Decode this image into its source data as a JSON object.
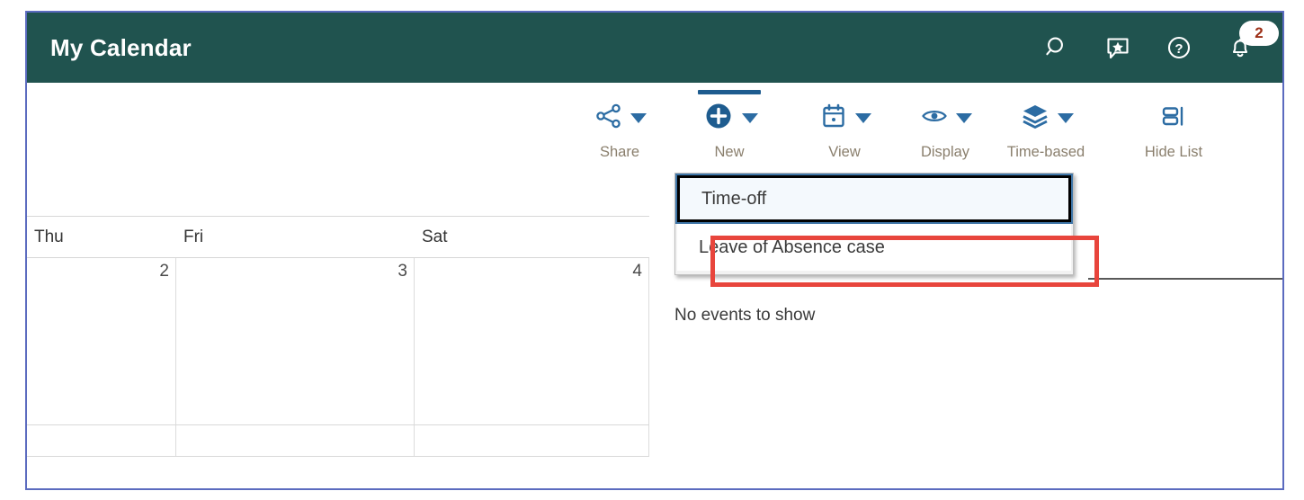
{
  "window": {
    "title": "My Calendar",
    "header_bg": "#20534f",
    "frame_border": "#5b6bbf"
  },
  "header_actions": [
    {
      "name": "search-icon",
      "label": "Search",
      "icon": "magnifier"
    },
    {
      "name": "feedback-icon",
      "label": "Feedback",
      "icon": "chat-star"
    },
    {
      "name": "help-icon",
      "label": "Help",
      "icon": "question-circle"
    },
    {
      "name": "notifications-icon",
      "label": "Notifications",
      "icon": "bell",
      "badge": "2"
    }
  ],
  "ribbon": {
    "accent": "#1e5c8f",
    "commands": [
      {
        "id": "share",
        "label": "Share",
        "icon": "share-nodes-icon",
        "has_caret": true,
        "active": false
      },
      {
        "id": "new",
        "label": "New",
        "icon": "plus-circle-icon",
        "has_caret": true,
        "active": true
      },
      {
        "id": "view",
        "label": "View",
        "icon": "calendar-icon",
        "has_caret": true,
        "active": false
      },
      {
        "id": "display",
        "label": "Display",
        "icon": "eye-icon",
        "has_caret": true,
        "active": false
      },
      {
        "id": "layers",
        "label": "Time-based",
        "icon": "layers-icon",
        "has_caret": true,
        "active": false
      },
      {
        "id": "hidelist",
        "label": "Hide List",
        "icon": "hide-list-icon",
        "has_caret": false,
        "active": false
      }
    ]
  },
  "new_menu": {
    "open": true,
    "items": [
      {
        "label": "Time-off",
        "focused": true,
        "highlighted": false
      },
      {
        "label": "Leave of Absence case",
        "focused": false,
        "highlighted": true
      }
    ],
    "highlight_color": "#e8453c"
  },
  "calendar": {
    "columns": [
      {
        "day": "Thu",
        "date": "2"
      },
      {
        "day": "Fri",
        "date": "3"
      },
      {
        "day": "Sat",
        "date": "4"
      }
    ]
  },
  "events_pane": {
    "empty_message": "No events to show"
  }
}
